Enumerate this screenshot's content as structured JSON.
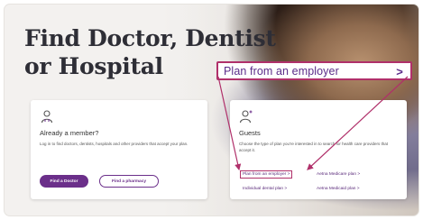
{
  "heading": {
    "line1": "Find Doctor, Dentist",
    "line2": "or Hospital"
  },
  "callout": {
    "label": "Plan from an employer",
    "chevron": ">"
  },
  "member_card": {
    "icon": "person-icon",
    "title": "Already a member?",
    "description": "Log in to find doctors, dentists, hospitals and other providers that accept your plan.",
    "primary_button": "Find a Doctor",
    "secondary_button": "Find a pharmacy"
  },
  "guest_card": {
    "icon": "person-plus-icon",
    "title": "Guests",
    "description": "Choose the type of plan you're interested in to search for health care providers that accept it.",
    "links": [
      {
        "label": "Plan from an employer >"
      },
      {
        "label": "Aetna Medicare plan >"
      },
      {
        "label": "Individual dental plan >"
      },
      {
        "label": "Aetna Medicaid plan >"
      }
    ]
  },
  "colors": {
    "brand_purple": "#6b2f8a",
    "highlight_magenta": "#b0306a",
    "heading_text": "#2e2e36"
  }
}
